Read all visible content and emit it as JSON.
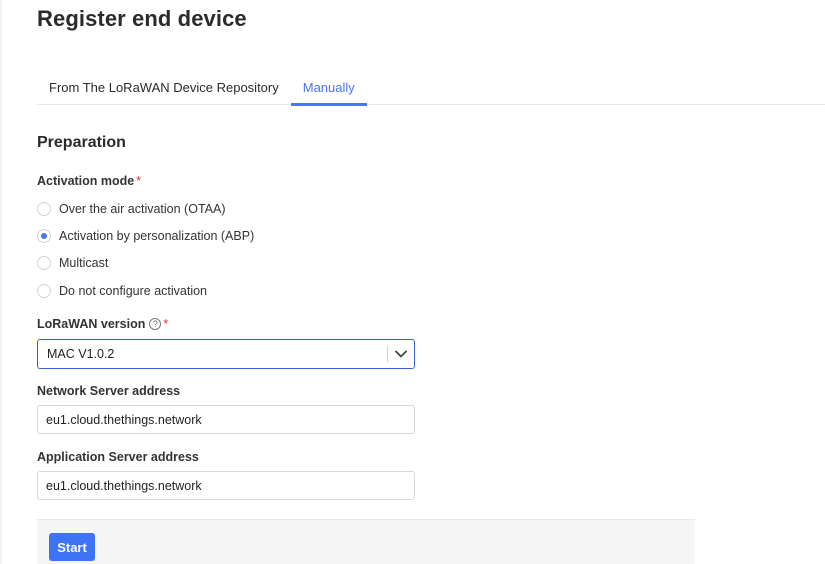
{
  "page": {
    "title": "Register end device"
  },
  "tabs": [
    {
      "label": "From The LoRaWAN Device Repository",
      "active": false
    },
    {
      "label": "Manually",
      "active": true
    }
  ],
  "preparation": {
    "title": "Preparation",
    "activation_mode": {
      "label": "Activation mode",
      "required_mark": "*",
      "options": [
        {
          "label": "Over the air activation (OTAA)",
          "checked": false
        },
        {
          "label": "Activation by personalization (ABP)",
          "checked": true
        },
        {
          "label": "Multicast",
          "checked": false
        },
        {
          "label": "Do not configure activation",
          "checked": false
        }
      ]
    },
    "lorawan_version": {
      "label": "LoRaWAN version",
      "help_icon": "?",
      "required_mark": "*",
      "selected": "MAC V1.0.2"
    },
    "network_server": {
      "label": "Network Server address",
      "value": "eu1.cloud.thethings.network"
    },
    "application_server": {
      "label": "Application Server address",
      "value": "eu1.cloud.thethings.network"
    }
  },
  "footer": {
    "start_label": "Start"
  },
  "colors": {
    "accent": "#4a76ef",
    "primary_button": "#3d74f5",
    "required": "#e0393e"
  },
  "icons": {
    "select_chevron": "chevron-down-icon",
    "help": "question-circle-icon"
  }
}
